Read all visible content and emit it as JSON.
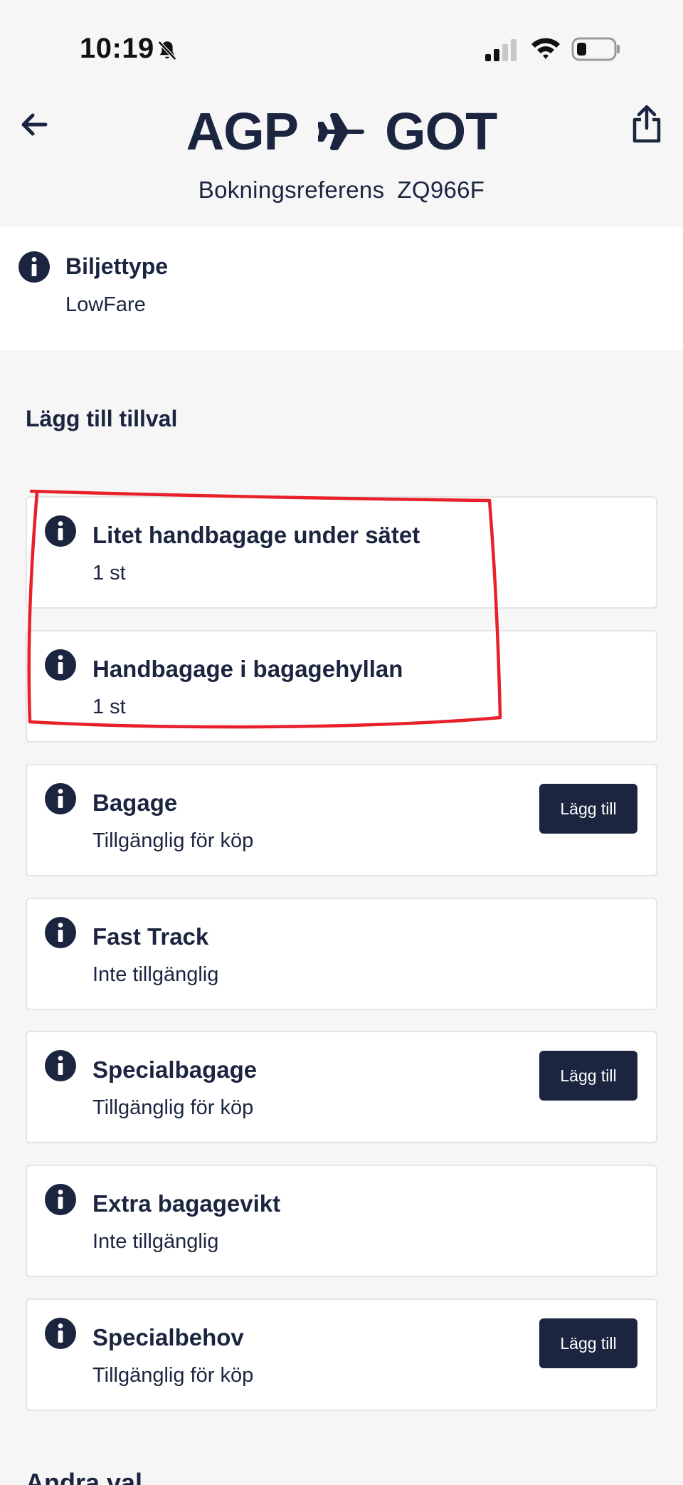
{
  "status_bar": {
    "time": "10:19"
  },
  "header": {
    "origin": "AGP",
    "destination": "GOT",
    "booking_label": "Bokningsreferens",
    "booking_code": "ZQ966F"
  },
  "ticket": {
    "title": "Biljettype",
    "value": "LowFare"
  },
  "addons": {
    "section_title": "Lägg till tillval",
    "items": [
      {
        "title": "Litet handbagage under sätet",
        "subtitle": "1 st",
        "button": ""
      },
      {
        "title": "Handbagage i bagagehyllan",
        "subtitle": "1 st",
        "button": ""
      },
      {
        "title": "Bagage",
        "subtitle": "Tillgänglig för köp",
        "button": "Lägg till"
      },
      {
        "title": "Fast Track",
        "subtitle": "Inte tillgänglig",
        "button": ""
      },
      {
        "title": "Specialbagage",
        "subtitle": "Tillgänglig för köp",
        "button": "Lägg till"
      },
      {
        "title": "Extra bagagevikt",
        "subtitle": "Inte tillgänglig",
        "button": ""
      },
      {
        "title": "Specialbehov",
        "subtitle": "Tillgänglig för köp",
        "button": "Lägg till"
      }
    ]
  },
  "next_section_title": "Andra val",
  "colors": {
    "navy": "#1b2540",
    "annotation_red": "#e8202a",
    "background": "#f6f6f6"
  }
}
